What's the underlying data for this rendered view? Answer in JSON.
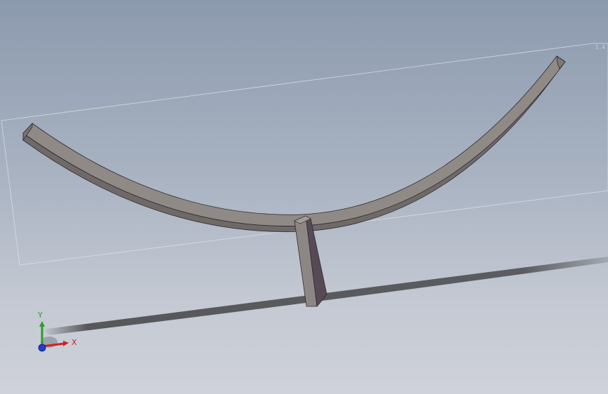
{
  "app": {
    "viewport": "3d-model-graphics-area"
  },
  "triad": {
    "y_label": "Y",
    "x_label": "X"
  },
  "model": {
    "parts": [
      "curved-beam",
      "vertical-plate"
    ],
    "colors": {
      "beam_top": "#8f8a86",
      "beam_side": "#6f6a68",
      "plate_front": "#574a55",
      "plate_side": "#8c8784",
      "edge": "#2c2a2c",
      "bounding_box": "#dfe3ea",
      "shadow": "#2b2b2b"
    }
  },
  "corner_tag": "1.4"
}
